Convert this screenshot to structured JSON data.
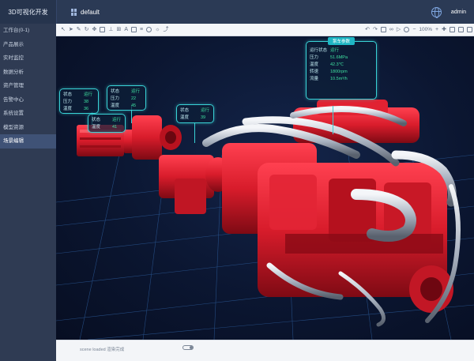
{
  "app": {
    "title": "3D可视化开发",
    "user": "admin"
  },
  "tab": {
    "label": "default"
  },
  "sidebar": {
    "items": [
      {
        "label": "工作台(0-1)"
      },
      {
        "label": "产品展示"
      },
      {
        "label": "实时监控"
      },
      {
        "label": "数据分析"
      },
      {
        "label": "资产管理"
      },
      {
        "label": "告警中心"
      },
      {
        "label": "系统设置"
      },
      {
        "label": "模型资源"
      },
      {
        "label": "场景编辑",
        "active": true
      }
    ]
  },
  "toolbar": {
    "left_icons": [
      "arrow-icon",
      "cursor-icon",
      "pen-icon",
      "rotate-icon",
      "move-icon",
      "box-icon",
      "ruler-icon",
      "grid-icon",
      "text-icon",
      "image-icon",
      "layer-icon",
      "camera-icon",
      "light-icon",
      "path-icon"
    ],
    "zoom": "100%"
  },
  "panels": [
    {
      "title": "泵车参数",
      "rows": [
        {
          "label": "运行状态",
          "value": "运行"
        },
        {
          "label": "压力",
          "value": "51.6MPa"
        },
        {
          "label": "温度",
          "value": "42.3℃"
        },
        {
          "label": "转速",
          "value": "1800rpm"
        },
        {
          "label": "流量",
          "value": "10.5m³/h"
        }
      ]
    },
    {
      "title": "",
      "rows": [
        {
          "label": "状态",
          "value": "运行"
        },
        {
          "label": "压力",
          "value": "38"
        },
        {
          "label": "温度",
          "value": "36"
        }
      ]
    },
    {
      "title": "",
      "rows": [
        {
          "label": "状态",
          "value": "运行"
        },
        {
          "label": "压力",
          "value": "22"
        },
        {
          "label": "温度",
          "value": "45"
        }
      ]
    },
    {
      "title": "",
      "rows": [
        {
          "label": "状态",
          "value": "运行"
        },
        {
          "label": "温度",
          "value": "41"
        }
      ]
    },
    {
      "title": "",
      "rows": [
        {
          "label": "状态",
          "value": "运行"
        },
        {
          "label": "温度",
          "value": "39"
        }
      ]
    }
  ],
  "status": {
    "text": "scene loaded 渲染完成"
  },
  "colors": {
    "header": "#2b3a55",
    "sidebar": "#2f3b53",
    "panel_border": "#39d2d6",
    "value": "#3fe0a0",
    "engine_red": "#d81c2b"
  }
}
